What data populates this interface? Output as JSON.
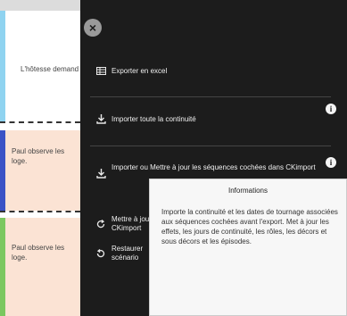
{
  "background": {
    "top_fragment": "...",
    "card1_text": "L'hôtesse demand",
    "card2_text": "Paul observe les loge.",
    "card3_text": "Paul observe les loge."
  },
  "panel": {
    "close_label": "×",
    "items": [
      {
        "label": "Exporter en excel",
        "icon": "table-icon"
      },
      {
        "label": "Importer toute la continuité",
        "icon": "download-icon"
      },
      {
        "label": "Importer ou Mettre à jour les séquences cochées dans CKimport",
        "icon": "download-icon"
      },
      {
        "label": "Mettre à jour CKimport",
        "icon": "refresh-icon"
      },
      {
        "label": "Restaurer scénario",
        "icon": "restore-icon"
      }
    ],
    "info_label": "i"
  },
  "tooltip": {
    "title": "Informations",
    "body": "Importe la continuité et les dates de tournage associées aux séquences cochées avant l'export. Met à jour les effets, les jours de continuité, les rôles, les décors et sous décors et les épisodes."
  },
  "colors": {
    "panel_bg": "#1c1c1c",
    "tooltip_bg": "#f7f7f7",
    "strip_blue": "#8fd3f0",
    "strip_navy": "#3a52c6",
    "strip_green": "#7bc860",
    "card_peach": "#fbe3d4"
  }
}
